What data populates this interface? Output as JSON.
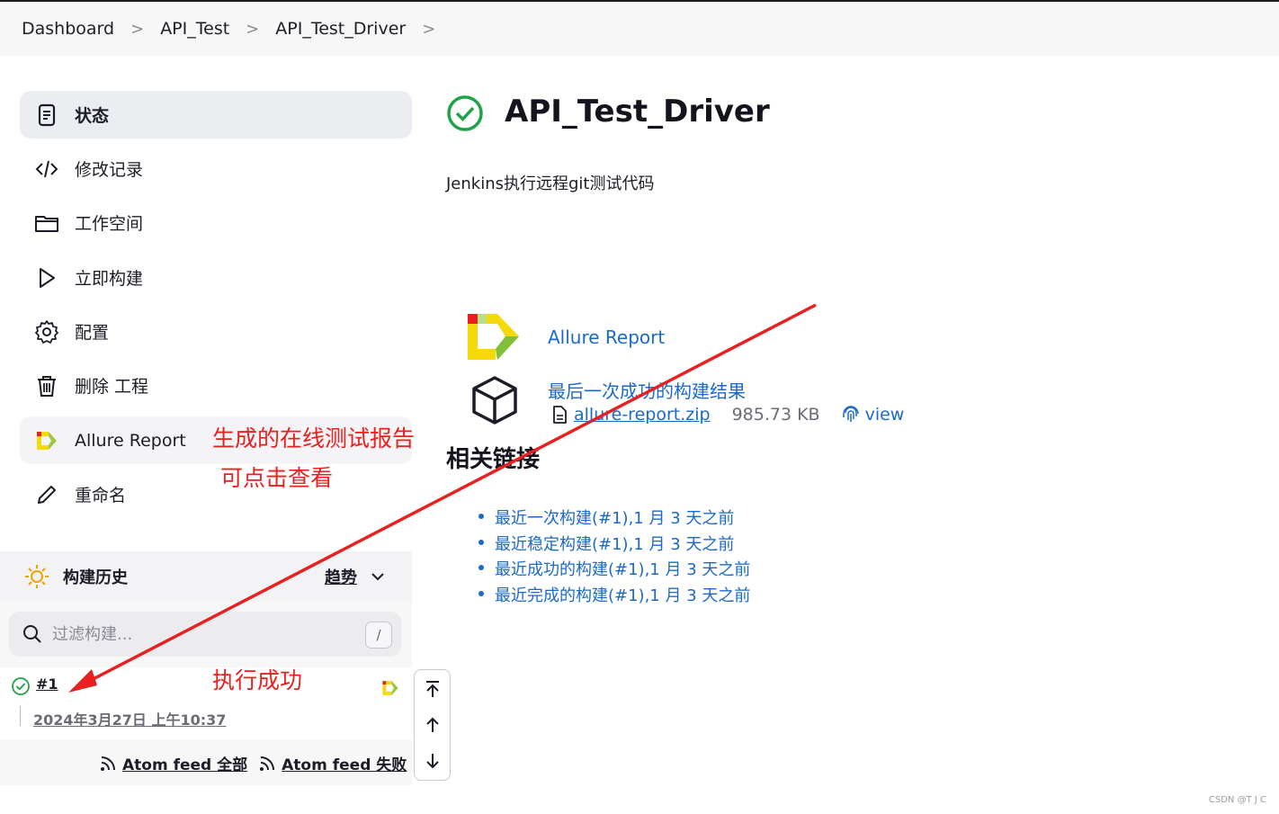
{
  "breadcrumb": [
    "Dashboard",
    "API_Test",
    "API_Test_Driver"
  ],
  "sidebar": {
    "items": [
      {
        "label": "状态",
        "icon": "status-document-icon"
      },
      {
        "label": "修改记录",
        "icon": "code-changes-icon"
      },
      {
        "label": "工作空间",
        "icon": "folder-icon"
      },
      {
        "label": "立即构建",
        "icon": "play-icon"
      },
      {
        "label": "配置",
        "icon": "gear-icon"
      },
      {
        "label": "删除 工程",
        "icon": "trash-icon"
      },
      {
        "label": "Allure Report",
        "icon": "allure-logo-icon"
      },
      {
        "label": "重命名",
        "icon": "pencil-icon"
      }
    ]
  },
  "build_history": {
    "title": "构建历史",
    "trend_label": "趋势",
    "filter_placeholder": "过滤构建...",
    "filter_shortcut": "/",
    "build": {
      "number": "#1",
      "date": "2024年3月27日 上午10:37"
    },
    "feed_all_prefix": "Atom feed ",
    "feed_all_suffix": "全部",
    "feed_fail_prefix": "Atom feed ",
    "feed_fail_suffix": "失败"
  },
  "main": {
    "title": "API_Test_Driver",
    "description": "Jenkins执行远程git测试代码",
    "allure_link": "Allure Report",
    "last_success_link": "最后一次成功的构建结果",
    "artifact_name": "allure-report.zip",
    "artifact_size": "985.73 KB",
    "artifact_view": "view",
    "related_title": "相关链接",
    "related_links": [
      "最近一次构建(#1),1 月 3 天之前",
      "最近稳定构建(#1),1 月 3 天之前",
      "最近成功的构建(#1),1 月 3 天之前",
      "最近完成的构建(#1),1 月 3 天之前"
    ]
  },
  "annotations": {
    "report_line1": "生成的在线测试报告",
    "report_line2": "可点击查看",
    "success": "执行成功"
  },
  "watermark": "CSDN @T J C",
  "colors": {
    "link": "#1b6ac9",
    "success": "#1ea446",
    "annotation": "#e8201f"
  }
}
